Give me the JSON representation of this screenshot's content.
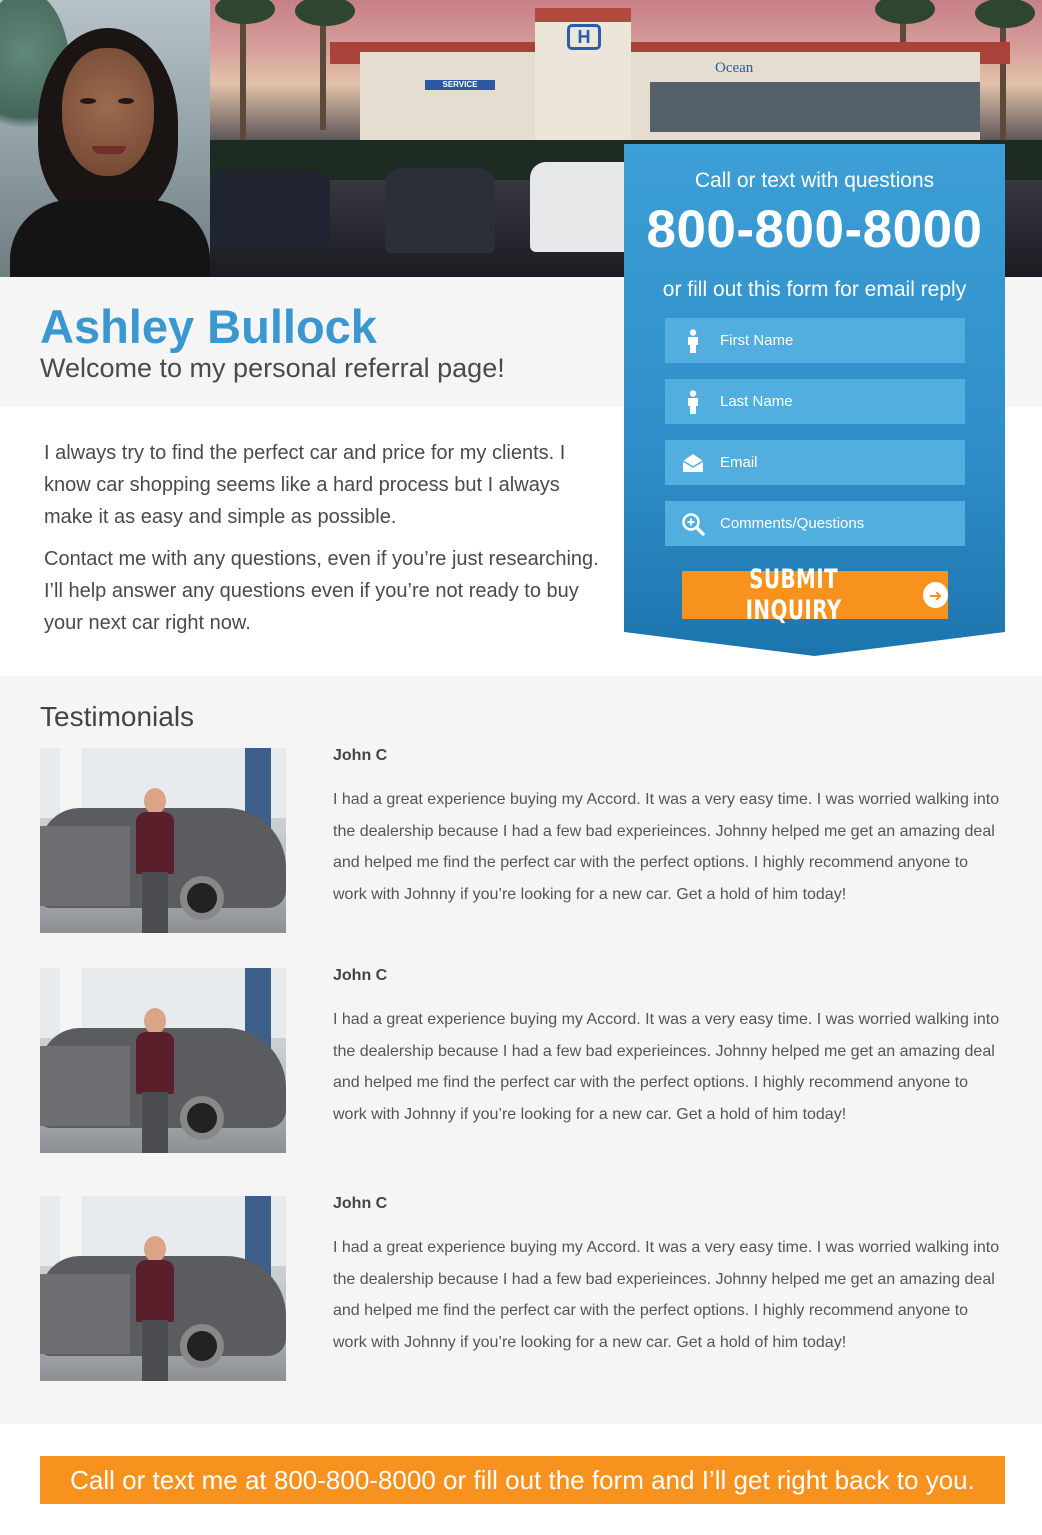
{
  "agent": {
    "name": "Ashley Bullock",
    "welcome": "Welcome to my personal referral page!",
    "bio": [
      "I always try to find the perfect car and price for my clients. I know car shopping seems like a hard process but I always make it as easy and simple as possible.",
      "Contact me with any questions, even if you’re just researching. I’ll help answer any questions even if you’re not ready to buy your next car right now."
    ]
  },
  "hero": {
    "dealer_sign": "Ocean",
    "service_sign": "SERVICE",
    "brand_letter": "H"
  },
  "form": {
    "heading": "Call or text with questions",
    "phone": "800-800-8000",
    "subheading": "or fill out this form for email reply",
    "fields": [
      {
        "placeholder": "First Name",
        "icon": "person-icon"
      },
      {
        "placeholder": "Last Name",
        "icon": "person-icon"
      },
      {
        "placeholder": "Email",
        "icon": "envelope-icon"
      },
      {
        "placeholder": "Comments/Questions",
        "icon": "magnifier-plus-icon"
      }
    ],
    "submit_label": "SUBMIT INQUIRY",
    "submit_icon": "arrow-circle-right-icon"
  },
  "testimonials": {
    "title": "Testimonials",
    "items": [
      {
        "name": "John C",
        "text": "I had a great experience buying my Accord. It was a very easy time. I was worried walking into the dealership because I had a few bad experieinces. Johnny helped me get an amazing deal and helped me find the perfect car with the perfect options. I highly recommend anyone to work with Johnny if you’re looking for a new car. Get a hold of him today!"
      },
      {
        "name": "John C",
        "text": "I had a great experience buying my Accord. It was a very easy time. I was worried walking into the dealership because I had a few bad experieinces. Johnny helped me get an amazing deal and helped me find the perfect car with the perfect options. I highly recommend anyone to work with Johnny if you’re looking for a new car. Get a hold of him today!"
      },
      {
        "name": "John C",
        "text": "I had a great experience buying my Accord. It was a very easy time. I was worried walking into the dealership because I had a few bad experieinces. Johnny helped me get an amazing deal and helped me find the perfect car with the perfect options. I highly recommend anyone to work with Johnny if you’re looking for a new car. Get a hold of him today!"
      }
    ]
  },
  "footer": {
    "cta": "Call or text me at 800-800-8000 or fill out the form and I’ll get right back to you."
  },
  "colors": {
    "accent_blue": "#3a97cf",
    "panel_blue": "#2f8ec9",
    "field_blue": "#52aede",
    "orange": "#f7921e",
    "band_gray": "#f5f5f5"
  }
}
